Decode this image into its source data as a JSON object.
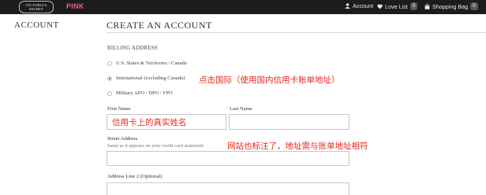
{
  "topbar": {
    "logo_line1": "VICTORIA'S",
    "logo_line2": "SECRET",
    "pink_label": "PINK",
    "account_label": "Account",
    "love_list_label": "Love List",
    "love_list_count": "0",
    "shopping_bag_label": "Shopping Bag",
    "shopping_bag_count": "0",
    "icons": [
      "user-icon",
      "heart-icon",
      "bag-icon"
    ]
  },
  "sidebar": {
    "heading": "ACCOUNT"
  },
  "main": {
    "title": "CREATE AN ACCOUNT",
    "billing_section_label": "BILLING ADDRESS",
    "address_type_options": [
      {
        "label": "U.S. States & Territories / Canada",
        "selected": false
      },
      {
        "label": "International (excluding Canada)",
        "selected": true
      },
      {
        "label": "Military APO / DPO / FPO",
        "selected": false
      }
    ],
    "first_name_label": "First Name",
    "last_name_label": "Last Name",
    "street_address_label": "Street Address",
    "street_address_hint": "Same as it appears on your credit card statement.",
    "address_line2_label": "Address Line 2 (Optional)",
    "first_name_value": "",
    "last_name_value": "",
    "street_address_value": "",
    "address_line2_value": ""
  },
  "annotations": {
    "international_note": "点击国际（使用国内信用卡账单地址）",
    "first_name_note": "信用卡上的真实姓名",
    "street_note": "网站也标注了，地址需与账单地址相符",
    "color": "#e8281b"
  },
  "colors": {
    "topbar_bg": "#1c1c1c",
    "pink_brand": "#e8618f",
    "badge_bg": "#5a5a5a"
  }
}
